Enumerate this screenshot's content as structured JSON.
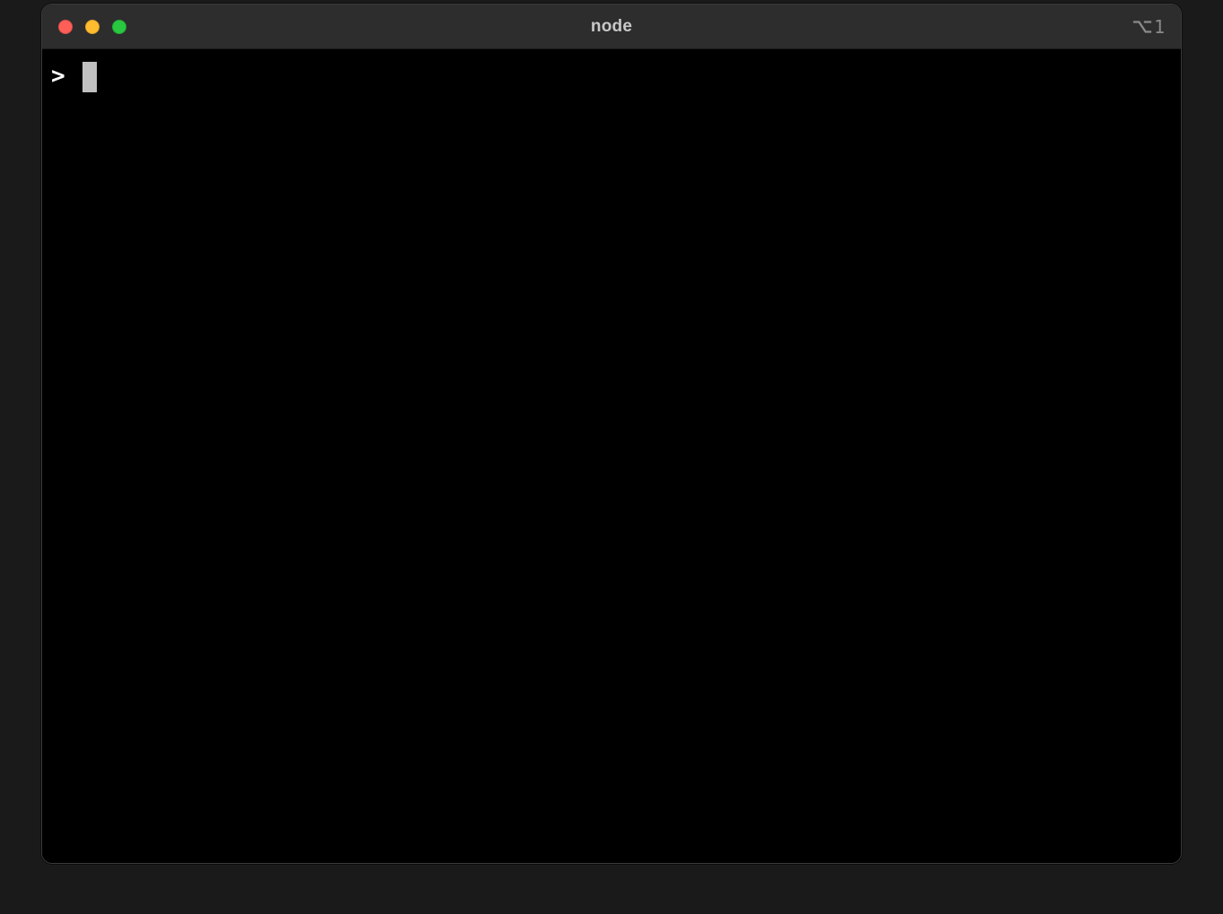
{
  "window": {
    "title": "node",
    "pane_indicator": "1"
  },
  "terminal": {
    "prompt": ">",
    "input_value": ""
  }
}
